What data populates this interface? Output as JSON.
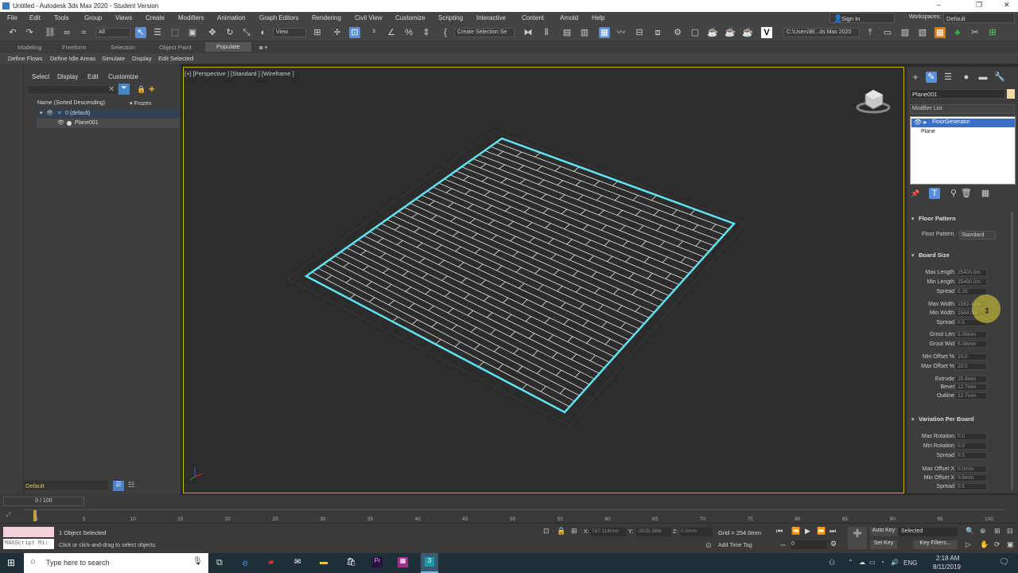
{
  "window": {
    "title": "Untitled - Autodesk 3ds Max 2020 - Student Version",
    "controls": [
      "–",
      "❐",
      "✕"
    ]
  },
  "menu": [
    "File",
    "Edit",
    "Tools",
    "Group",
    "Views",
    "Create",
    "Modifiers",
    "Animation",
    "Graph Editors",
    "Rendering",
    "Civil View",
    "Customize",
    "Scripting",
    "Interactive",
    "Content",
    "Arnold",
    "Help"
  ],
  "account": {
    "sign_in": "Sign In",
    "workspaces_label": "Workspaces:",
    "workspace": "Default"
  },
  "toolbar": {
    "filter": "All",
    "refcoord": "View",
    "selection_set": "Create Selection Se",
    "path": "C:\\Users\\Bl...ds Max 2020"
  },
  "ribbon": {
    "tabs": [
      "Modeling",
      "Freeform",
      "Selection",
      "Object Paint",
      "Populate"
    ],
    "active_tab": "Populate",
    "tools": [
      "Define Flows",
      "Define Idle Areas",
      "Simulate",
      "Display",
      "Edit Selected"
    ]
  },
  "scene_explorer": {
    "tabs": [
      "Select",
      "Display",
      "Edit",
      "Customize"
    ],
    "col_name": "Name (Sorted Descending)",
    "col_frozen": "Frozen",
    "items": [
      {
        "name": "0 (default)"
      },
      {
        "name": "Plane001"
      }
    ],
    "layer": "Default"
  },
  "viewport": {
    "label": "[+] [Perspective ] [Standard ] [Wireframe ]"
  },
  "command_panel": {
    "object_name": "Plane001",
    "modifier_list": "Modifier List",
    "stack": [
      "FloorGenerator",
      "Plane"
    ],
    "floor_pattern": {
      "title": "Floor Pattern",
      "label": "Floor Pattern",
      "value": "Standard"
    },
    "board_size": {
      "title": "Board Size",
      "params": [
        {
          "label": "Max Length",
          "value": "25400.0m"
        },
        {
          "label": "Min Length",
          "value": "25400.0m"
        },
        {
          "label": "Spread",
          "value": "0.25"
        },
        {
          "label": "Max Width",
          "value": "1582.42m"
        },
        {
          "label": "Min Width",
          "value": "1584.0m"
        },
        {
          "label": "Spread",
          "value": "0.5"
        },
        {
          "label": "Grout Len",
          "value": "5.08mm"
        },
        {
          "label": "Grout Wid",
          "value": "5.08mm"
        },
        {
          "label": "Min Offset %",
          "value": "20.0"
        },
        {
          "label": "Max Offset %",
          "value": "20.0"
        },
        {
          "label": "Extrude",
          "value": "25.4mm"
        },
        {
          "label": "Bevel",
          "value": "12.7mm"
        },
        {
          "label": "Outline",
          "value": "12.7mm"
        }
      ]
    },
    "variation": {
      "title": "Variation Per Board",
      "params": [
        {
          "label": "Max Rotation",
          "value": "0.0"
        },
        {
          "label": "Min Rotation",
          "value": "0.0"
        },
        {
          "label": "Spread",
          "value": "0.5"
        },
        {
          "label": "Max Offset X",
          "value": "0.0mm"
        },
        {
          "label": "Min Offset X",
          "value": "0.0mm"
        },
        {
          "label": "Spread",
          "value": "0.5"
        }
      ]
    }
  },
  "timeline": {
    "frame": "0 / 100",
    "ticks": [
      "0",
      "5",
      "10",
      "15",
      "20",
      "25",
      "30",
      "35",
      "40",
      "45",
      "50",
      "55",
      "60",
      "65",
      "70",
      "75",
      "80",
      "85",
      "90",
      "95",
      "100"
    ]
  },
  "status": {
    "maxscript": "MAXScript Mi:",
    "selected": "1 Object Selected",
    "hint": "Click or click-and-drag to select objects",
    "x_label": "X:",
    "x": "787.114mm",
    "y_label": "Y:",
    "y": "-3535.986r",
    "z_label": "Z:",
    "z": "0.0mm",
    "grid": "Grid = 254.0mm",
    "add_time_tag": "Add Time Tag",
    "frame_field": "0",
    "auto_key": "Auto Key",
    "set_key": "Set Key",
    "selected_combo": "Selected",
    "key_filters": "Key Filters..."
  },
  "taskbar": {
    "search": "Type here to search",
    "lang": "ENG",
    "time": "2:18 AM",
    "date": "8/11/2019"
  }
}
